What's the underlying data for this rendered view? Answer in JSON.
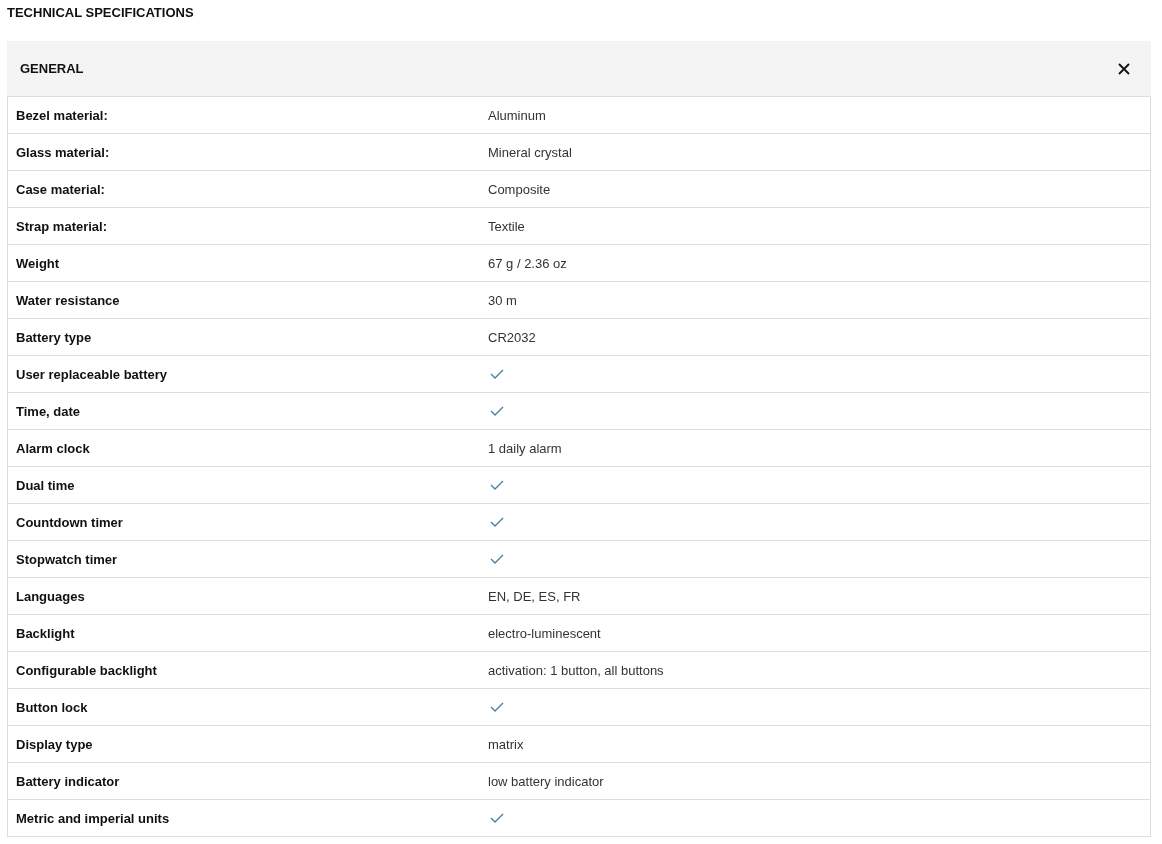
{
  "title": "TECHNICAL SPECIFICATIONS",
  "section": {
    "title": "GENERAL",
    "expanded": true,
    "rows": [
      {
        "label": "Bezel material:",
        "kind": "text",
        "value": "Aluminum"
      },
      {
        "label": "Glass material:",
        "kind": "text",
        "value": "Mineral crystal"
      },
      {
        "label": "Case material:",
        "kind": "text",
        "value": "Composite"
      },
      {
        "label": "Strap material:",
        "kind": "text",
        "value": "Textile"
      },
      {
        "label": "Weight",
        "kind": "text",
        "value": "67 g / 2.36 oz"
      },
      {
        "label": "Water resistance",
        "kind": "text",
        "value": "30 m"
      },
      {
        "label": "Battery type",
        "kind": "text",
        "value": "CR2032"
      },
      {
        "label": "User replaceable battery",
        "kind": "check"
      },
      {
        "label": "Time, date",
        "kind": "check"
      },
      {
        "label": "Alarm clock",
        "kind": "text",
        "value": "1 daily alarm"
      },
      {
        "label": "Dual time",
        "kind": "check"
      },
      {
        "label": "Countdown timer",
        "kind": "check"
      },
      {
        "label": "Stopwatch timer",
        "kind": "check"
      },
      {
        "label": "Languages",
        "kind": "text",
        "value": "EN, DE, ES, FR"
      },
      {
        "label": "Backlight",
        "kind": "text",
        "value": "electro-luminescent"
      },
      {
        "label": "Configurable backlight",
        "kind": "text",
        "value": "activation: 1 button, all buttons"
      },
      {
        "label": "Button lock",
        "kind": "check"
      },
      {
        "label": "Display type",
        "kind": "text",
        "value": "matrix"
      },
      {
        "label": "Battery indicator",
        "kind": "text",
        "value": "low battery indicator"
      },
      {
        "label": "Metric and imperial units",
        "kind": "check"
      }
    ]
  }
}
